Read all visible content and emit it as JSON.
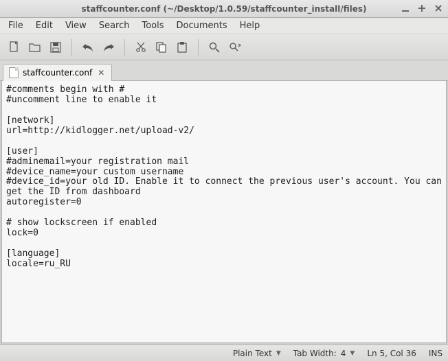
{
  "window": {
    "title": "staffcounter.conf (~/Desktop/1.0.59/staffcounter_install/files)"
  },
  "menu": {
    "file": "File",
    "edit": "Edit",
    "view": "View",
    "search": "Search",
    "tools": "Tools",
    "documents": "Documents",
    "help": "Help"
  },
  "tabs": [
    {
      "label": "staffcounter.conf"
    }
  ],
  "editor": {
    "content": "#comments begin with #\n#uncomment line to enable it\n\n[network]\nurl=http://kidlogger.net/upload-v2/\n\n[user]\n#adminemail=your registration mail\n#device_name=your custom username\n#device_id=your old ID. Enable it to connect the previous user's account. You can get the ID from dashboard\nautoregister=0\n\n# show lockscreen if enabled\nlock=0\n\n[language]\nlocale=ru_RU\n"
  },
  "status": {
    "syntax": "Plain Text",
    "tabwidth_label": "Tab Width:",
    "tabwidth_value": "4",
    "cursor": "Ln 5, Col 36",
    "insert_mode": "INS"
  }
}
